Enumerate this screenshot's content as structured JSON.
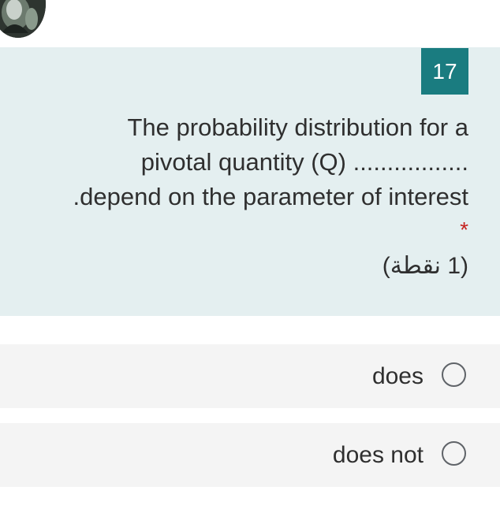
{
  "avatar": {
    "icon": "user-avatar-icon"
  },
  "question": {
    "number": "17",
    "text_lines": [
      "The probability distribution for a",
      "pivotal quantity (Q) .................",
      ".depend on the parameter of interest"
    ],
    "required_mark": "*",
    "points": "(1 نقطة)"
  },
  "options": [
    {
      "label": "does"
    },
    {
      "label": "does not"
    }
  ],
  "colors": {
    "card_background": "#e4eff0",
    "number_badge": "#1a7c80",
    "required": "#c5221f",
    "option_background": "#f4f4f4"
  }
}
